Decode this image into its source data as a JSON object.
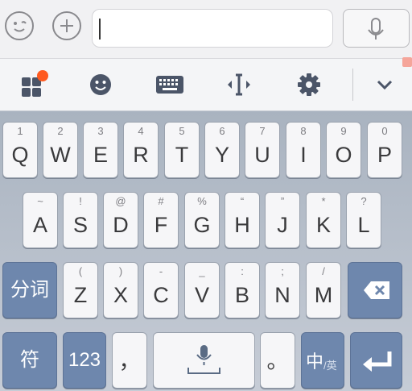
{
  "topbar": {
    "emoji_icon": "smiley-face-icon",
    "add_icon": "plus-circle-icon",
    "input_value": "",
    "mic_icon": "microphone-icon"
  },
  "toolbar": {
    "icons": [
      "apps-grid-icon",
      "smiley-icon",
      "keyboard-icon",
      "text-cursor-icon",
      "gear-icon",
      "chevron-down-icon"
    ],
    "notification_color": "#ff5a1f"
  },
  "keyboard": {
    "row1": [
      {
        "main": "Q",
        "sub": "1"
      },
      {
        "main": "W",
        "sub": "2"
      },
      {
        "main": "E",
        "sub": "3"
      },
      {
        "main": "R",
        "sub": "4"
      },
      {
        "main": "T",
        "sub": "5"
      },
      {
        "main": "Y",
        "sub": "6"
      },
      {
        "main": "U",
        "sub": "7"
      },
      {
        "main": "I",
        "sub": "8"
      },
      {
        "main": "O",
        "sub": "9"
      },
      {
        "main": "P",
        "sub": "0"
      }
    ],
    "row2": [
      {
        "main": "A",
        "sub": "~"
      },
      {
        "main": "S",
        "sub": "!"
      },
      {
        "main": "D",
        "sub": "@"
      },
      {
        "main": "F",
        "sub": "#"
      },
      {
        "main": "G",
        "sub": "%"
      },
      {
        "main": "H",
        "sub": "“"
      },
      {
        "main": "J",
        "sub": "”"
      },
      {
        "main": "K",
        "sub": "*"
      },
      {
        "main": "L",
        "sub": "?"
      }
    ],
    "row3": {
      "left": "分词",
      "letters": [
        {
          "main": "Z",
          "sub": "("
        },
        {
          "main": "X",
          "sub": ")"
        },
        {
          "main": "C",
          "sub": "-"
        },
        {
          "main": "V",
          "sub": "_"
        },
        {
          "main": "B",
          "sub": ":"
        },
        {
          "main": "N",
          "sub": ";"
        },
        {
          "main": "M",
          "sub": "/"
        }
      ],
      "backspace_icon": "backspace-icon"
    },
    "row4": {
      "symbol": "符",
      "num": "123",
      "comma": "，",
      "space_icon": "microphone-icon",
      "period": "。",
      "lang_main": "中",
      "lang_sub": "/英",
      "enter_icon": "enter-icon"
    },
    "colors": {
      "accent": "#6e87ad",
      "key": "#f6f6f8"
    }
  }
}
